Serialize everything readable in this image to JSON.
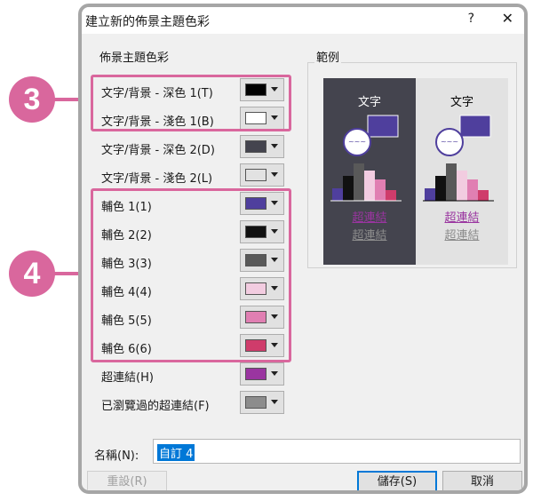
{
  "dialog": {
    "title": "建立新的佈景主題色彩",
    "help": "?",
    "close": "✕"
  },
  "theme_colors": {
    "group_label": "佈景主題色彩",
    "rows": [
      {
        "label": "文字/背景 - 深色 1(T)",
        "color": "#000000"
      },
      {
        "label": "文字/背景 - 淺色 1(B)",
        "color": "#ffffff"
      },
      {
        "label": "文字/背景 - 深色 2(D)",
        "color": "#44444e"
      },
      {
        "label": "文字/背景 - 淺色 2(L)",
        "color": "#e2e2e2"
      },
      {
        "label": "輔色 1(1)",
        "color": "#4f3f9d"
      },
      {
        "label": "輔色 2(2)",
        "color": "#111111"
      },
      {
        "label": "輔色 3(3)",
        "color": "#595959"
      },
      {
        "label": "輔色 4(4)",
        "color": "#f2cce0"
      },
      {
        "label": "輔色 5(5)",
        "color": "#e07fb2"
      },
      {
        "label": "輔色 6(6)",
        "color": "#cf3c6b"
      },
      {
        "label": "超連結(H)",
        "color": "#9a35a0"
      },
      {
        "label": "已瀏覽過的超連結(F)",
        "color": "#8c8c8c"
      }
    ]
  },
  "sample": {
    "group_label": "範例",
    "dark": {
      "text": "文字",
      "hyperlink": "超連結",
      "visited": "超連結",
      "bg": "#44444e",
      "fg": "#ffffff"
    },
    "light": {
      "text": "文字",
      "hyperlink": "超連結",
      "visited": "超連結",
      "bg": "#e2e2e2",
      "fg": "#000000"
    }
  },
  "callouts": {
    "three": "3",
    "four": "4"
  },
  "name": {
    "label": "名稱(N):",
    "value": "自訂 4"
  },
  "buttons": {
    "reset": "重設(R)",
    "save": "儲存(S)",
    "cancel": "取消"
  },
  "accent": "#d9679d"
}
